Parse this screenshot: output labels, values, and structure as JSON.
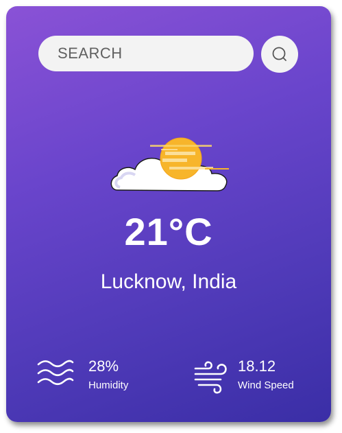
{
  "search": {
    "placeholder": "SEARCH",
    "button_icon": "search-icon"
  },
  "weather": {
    "icon": "sun-behind-cloud-icon",
    "temperature": "21°C",
    "location": "Lucknow, India"
  },
  "stats": {
    "humidity": {
      "icon": "humidity-waves-icon",
      "value": "28%",
      "label": "Humidity"
    },
    "wind": {
      "icon": "wind-icon",
      "value": "18.12",
      "label": "Wind Speed"
    }
  },
  "colors": {
    "gradient_start": "#8a52d6",
    "gradient_end": "#3a2ea6",
    "sun": "#f7b52b",
    "text": "#ffffff"
  }
}
